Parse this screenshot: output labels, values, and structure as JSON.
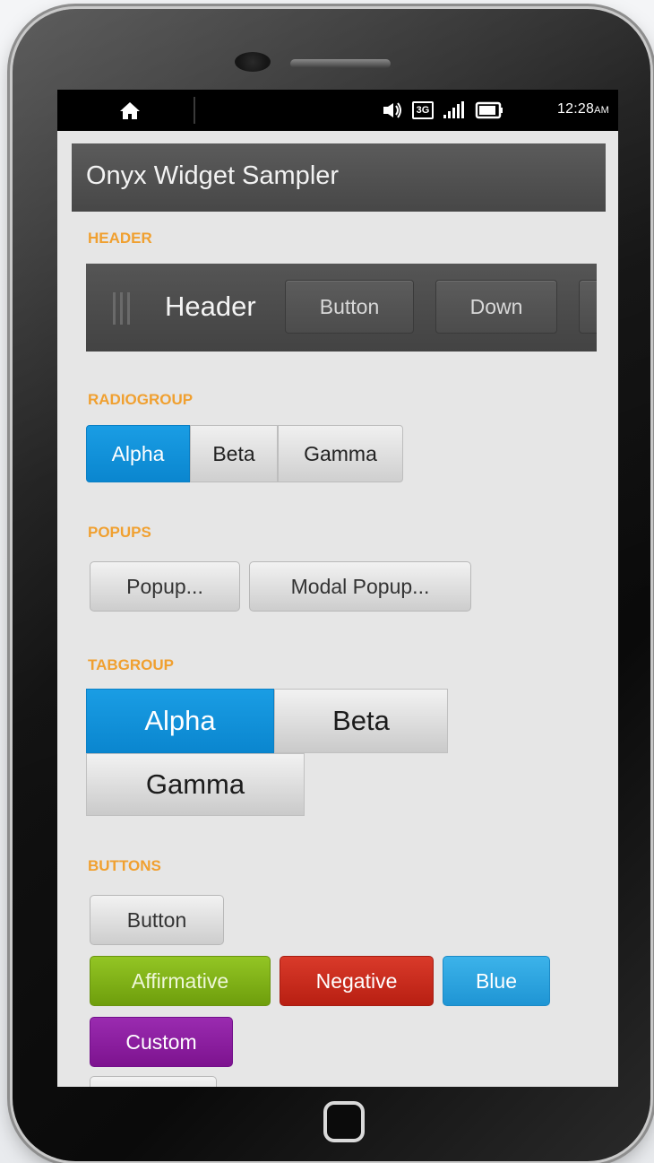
{
  "status_bar": {
    "time": "12:28",
    "ampm": "AM",
    "network": "3G",
    "icons": [
      "home-icon",
      "speaker-icon",
      "3g-icon",
      "signal-icon",
      "battery-icon"
    ]
  },
  "app": {
    "title": "Onyx Widget Sampler"
  },
  "sections": {
    "header": {
      "label": "HEADER",
      "toolbar_title": "Header",
      "buttons": [
        "Button",
        "Down"
      ]
    },
    "radiogroup": {
      "label": "RADIOGROUP",
      "options": [
        "Alpha",
        "Beta",
        "Gamma"
      ],
      "selected": "Alpha"
    },
    "popups": {
      "label": "POPUPS",
      "buttons": [
        "Popup...",
        "Modal Popup..."
      ]
    },
    "tabgroup": {
      "label": "TABGROUP",
      "tabs": [
        "Alpha",
        "Beta",
        "Gamma"
      ],
      "selected": "Alpha"
    },
    "buttons": {
      "label": "BUTTONS",
      "plain": "Button",
      "affirmative": "Affirmative",
      "negative": "Negative",
      "blue": "Blue",
      "custom": "Custom"
    }
  },
  "colors": {
    "accent_blue": "#0a86cf",
    "section_label": "#f0a030",
    "affirmative": "#7fb118",
    "negative": "#c52a1c",
    "blue": "#2ba4df",
    "custom": "#8a1fa0"
  }
}
